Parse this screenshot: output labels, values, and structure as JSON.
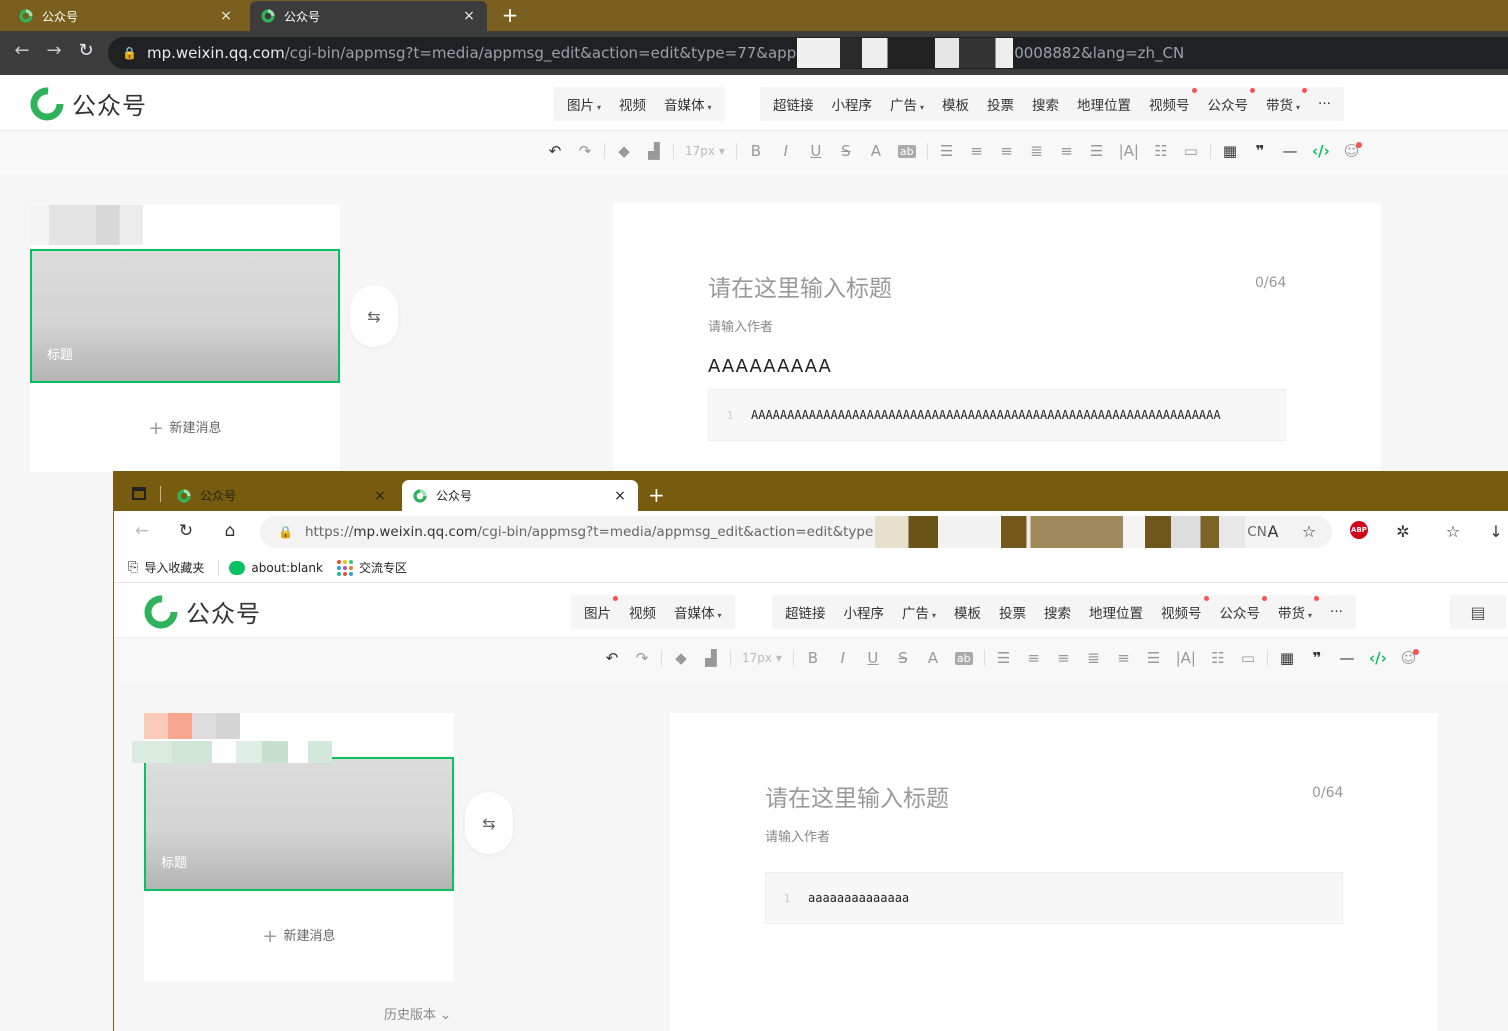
{
  "browser1": {
    "tabs": [
      {
        "label": "公众号",
        "close": "×"
      },
      {
        "label": "公众号",
        "close": "×"
      }
    ],
    "new_tab": "+",
    "url_host": "mp.weixin.qq.com",
    "url_path": "/cgi-bin/appmsg?t=media/appmsg_edit&action=edit&type=77&app",
    "url_tail": "0008882&lang=zh_CN"
  },
  "browser2": {
    "tabs": [
      {
        "label": "公众号",
        "close": "×"
      },
      {
        "label": "公众号",
        "close": "×"
      }
    ],
    "new_tab": "+",
    "url_prefix": "https://",
    "url_host": "mp.weixin.qq.com",
    "url_path": "/cgi-bin/appmsg?t=media/appmsg_edit&action=edit&type",
    "url_tail": "CN",
    "favorites": [
      "导入收藏夹",
      "about:blank",
      "交流专区"
    ]
  },
  "logo_text": "公众号",
  "menu1": {
    "group_a": [
      {
        "label": "图片",
        "caret": "▾"
      },
      {
        "label": "视频"
      },
      {
        "label": "音媒体",
        "caret": "▾"
      }
    ],
    "group_b": [
      {
        "label": "超链接"
      },
      {
        "label": "小程序"
      },
      {
        "label": "广告",
        "caret": "▾"
      },
      {
        "label": "模板"
      },
      {
        "label": "投票"
      },
      {
        "label": "搜索"
      },
      {
        "label": "地理位置"
      },
      {
        "label": "视频号",
        "dot": true
      },
      {
        "label": "公众号",
        "dot": true
      },
      {
        "label": "带货",
        "caret": "▾",
        "dot": true
      },
      {
        "label": "···"
      }
    ]
  },
  "menu2": {
    "group_a": [
      {
        "label": "图片",
        "dot": true
      },
      {
        "label": "视频"
      },
      {
        "label": "音媒体",
        "caret": "▾"
      }
    ]
  },
  "toolbar": {
    "font_size": "17px",
    "bold": "B",
    "italic": "I",
    "underline": "U",
    "strike": "S",
    "font_color": "A",
    "bg_color": "ab"
  },
  "article": {
    "cover_title": "标题",
    "new_message": "新建消息",
    "history": "历史版本"
  },
  "editor1": {
    "title_placeholder": "请在这里输入标题",
    "title_count": "0/64",
    "author_placeholder": "请输入作者",
    "heading": "AAAAAAAAA",
    "code_line_no": "1",
    "code_text": "AAAAAAAAAAAAAAAAAAAAAAAAAAAAAAAAAAAAAAAAAAAAAAAAAAAAAAAAAAAAAAAAA"
  },
  "editor2": {
    "title_placeholder": "请在这里输入标题",
    "title_count": "0/64",
    "author_placeholder": "请输入作者",
    "code_line_no": "1",
    "code_text": "aaaaaaaaaaaaaa"
  },
  "colors": {
    "brand_green": "#07c160",
    "tab_bar_brown": "#7a5f1e",
    "notify_red": "#fa5151"
  }
}
